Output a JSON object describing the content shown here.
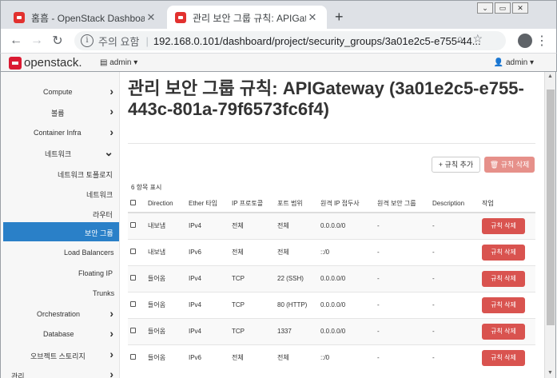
{
  "browser": {
    "tabs": [
      {
        "title": "홈흠 - OpenStack Dashboard"
      },
      {
        "title": "관리 보안 그룹 규칙: APIGatewa"
      }
    ],
    "new_tab": "+",
    "window_controls": [
      "⌄",
      "▭",
      "✕"
    ],
    "address": {
      "security_label": "주의 요함",
      "url": "192.168.0.101/dashboard/project/security_groups/3a01e2c5-e755-44..."
    }
  },
  "header": {
    "logo": "openstack.",
    "project": "admin ▾",
    "user": "admin ▾"
  },
  "sidebar": {
    "items": [
      {
        "label": "Compute",
        "chevron": "›"
      },
      {
        "label": "볼륨",
        "chevron": "›"
      },
      {
        "label": "Container Infra",
        "chevron": "›"
      },
      {
        "label": "네트워크",
        "chevron": "⌄"
      },
      {
        "label": "네트워크 토폴로지",
        "chevron": ""
      },
      {
        "label": "네트워크",
        "chevron": ""
      },
      {
        "label": "라우터",
        "chevron": ""
      },
      {
        "label": "보안 그룹",
        "chevron": ""
      },
      {
        "label": "Load Balancers",
        "chevron": ""
      },
      {
        "label": "Floating IP",
        "chevron": ""
      },
      {
        "label": "Trunks",
        "chevron": ""
      },
      {
        "label": "Orchestration",
        "chevron": "›"
      },
      {
        "label": "Database",
        "chevron": "›"
      },
      {
        "label": "오브젝트 스토리지",
        "chevron": "›"
      },
      {
        "label": "관리",
        "chevron": "›"
      }
    ],
    "active_index": 7
  },
  "main": {
    "title": "관리 보안 그룹 규칙: APIGateway (3a01e2c5-e755-443c-801a-79f6573fc6f4)",
    "add_rule_button": "+ 규칙 추가",
    "delete_rules_button": "🗑 규칙 삭제",
    "count_label": "6 항목 표시",
    "columns": [
      "Direction",
      "Ether 타입",
      "IP 프로토콜",
      "포트 범위",
      "원격 IP 접두사",
      "원격 보안 그룹",
      "Description",
      "작업"
    ],
    "rows": [
      {
        "direction": "내보냄",
        "ether": "IPv4",
        "protocol": "전체",
        "port": "전체",
        "remote_ip": "0.0.0.0/0",
        "remote_group": "-",
        "description": "-",
        "action": "규칙 삭제"
      },
      {
        "direction": "내보냄",
        "ether": "IPv6",
        "protocol": "전체",
        "port": "전체",
        "remote_ip": "::/0",
        "remote_group": "-",
        "description": "-",
        "action": "규칙 삭제"
      },
      {
        "direction": "들어옴",
        "ether": "IPv4",
        "protocol": "TCP",
        "port": "22 (SSH)",
        "remote_ip": "0.0.0.0/0",
        "remote_group": "-",
        "description": "-",
        "action": "규칙 삭제"
      },
      {
        "direction": "들어옴",
        "ether": "IPv4",
        "protocol": "TCP",
        "port": "80 (HTTP)",
        "remote_ip": "0.0.0.0/0",
        "remote_group": "-",
        "description": "-",
        "action": "규칙 삭제"
      },
      {
        "direction": "들어옴",
        "ether": "IPv4",
        "protocol": "TCP",
        "port": "1337",
        "remote_ip": "0.0.0.0/0",
        "remote_group": "-",
        "description": "-",
        "action": "규칙 삭제"
      },
      {
        "direction": "들어옴",
        "ether": "IPv6",
        "protocol": "전체",
        "port": "전체",
        "remote_ip": "::/0",
        "remote_group": "-",
        "description": "-",
        "action": "규칙 삭제"
      }
    ]
  },
  "colors": {
    "accent": "#2a80c8",
    "danger": "#d9534f",
    "brand": "#da1a32"
  }
}
